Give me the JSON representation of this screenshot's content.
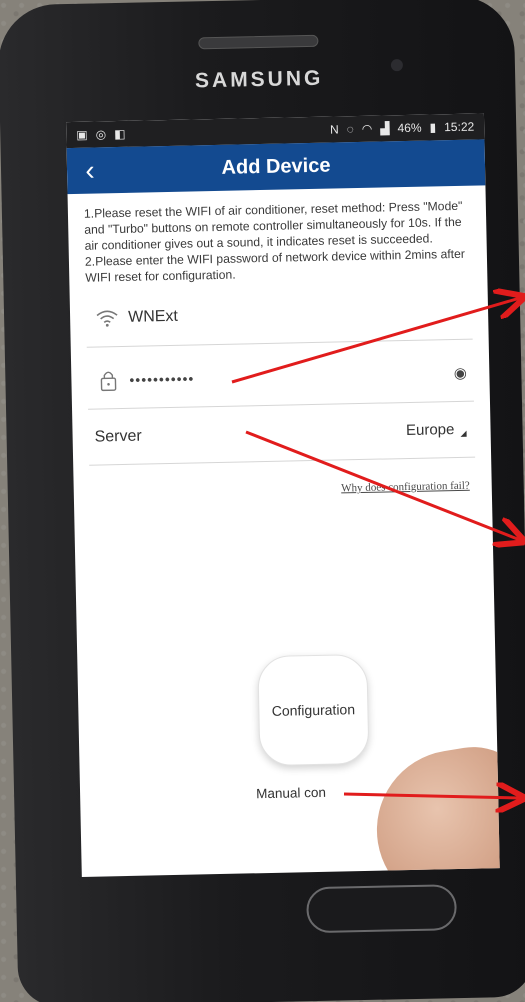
{
  "device": {
    "brand": "SAMSUNG"
  },
  "status_bar": {
    "time": "15:22",
    "battery": "46%"
  },
  "app_bar": {
    "title": "Add Device",
    "back_label": "‹"
  },
  "instructions": {
    "line1": "1.Please reset the WIFI of air conditioner, reset method: Press \"Mode\" and \"Turbo\" buttons on remote controller simultaneously for 10s. If the air conditioner gives out a sound, it indicates reset is succeeded.",
    "line2": "2.Please enter the WIFI password of network device within 2mins after WIFI reset for configuration."
  },
  "wifi": {
    "ssid": "WNExt",
    "icon": "wifi-icon"
  },
  "password": {
    "value": "•••••••••••",
    "icon": "lock-icon",
    "toggle_icon": "eye-icon"
  },
  "server": {
    "label": "Server",
    "value": "Europe"
  },
  "help_link": "Why does configuration fail?",
  "configuration_button": "Configuration",
  "manual_link": "Manual con",
  "colors": {
    "app_bar": "#134a90",
    "annotation": "#e11c1c"
  }
}
